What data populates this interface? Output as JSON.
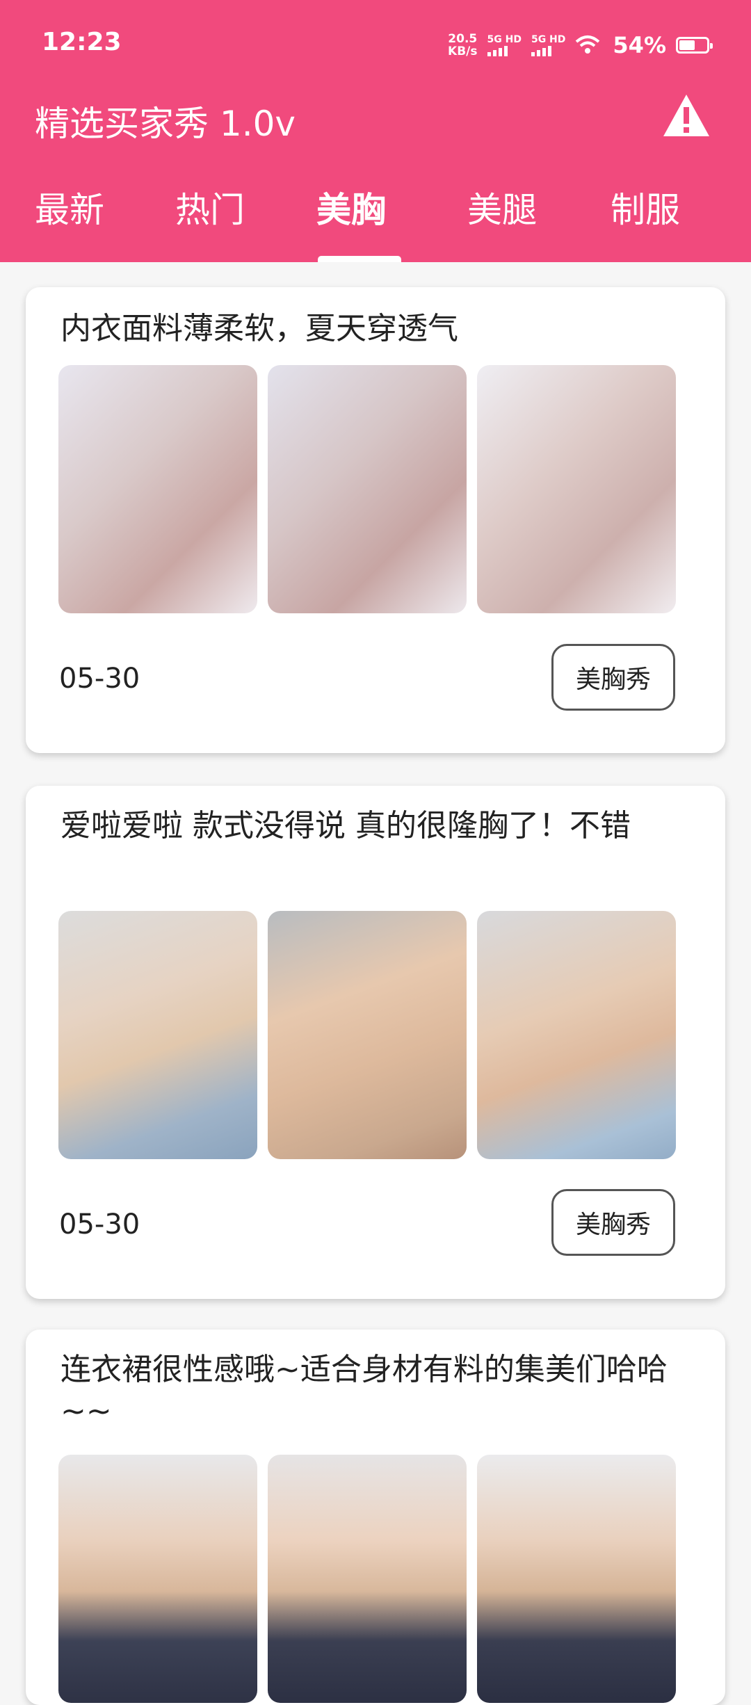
{
  "status_bar": {
    "time": "12:23",
    "net_speed_value": "20.5",
    "net_speed_unit": "KB/s",
    "sim1": "5G HD",
    "sim2": "5G HD",
    "battery": "54%"
  },
  "app": {
    "title": "精选买家秀 1.0v",
    "accent_color": "#f14a7d",
    "tabs": [
      {
        "label": "最新"
      },
      {
        "label": "热门"
      },
      {
        "label": "美胸"
      },
      {
        "label": "美腿"
      },
      {
        "label": "制服"
      }
    ],
    "active_tab": "美胸"
  },
  "feed": [
    {
      "text": "内衣面料薄柔软，夏天穿透气",
      "date": "05-30",
      "tag": "美胸秀"
    },
    {
      "text": "爱啦爱啦 款式没得说 真的很隆胸了！不错",
      "date": "05-30",
      "tag": "美胸秀"
    },
    {
      "text": "连衣裙很性感哦~适合身材有料的集美们哈哈~~",
      "date": "",
      "tag": ""
    }
  ]
}
